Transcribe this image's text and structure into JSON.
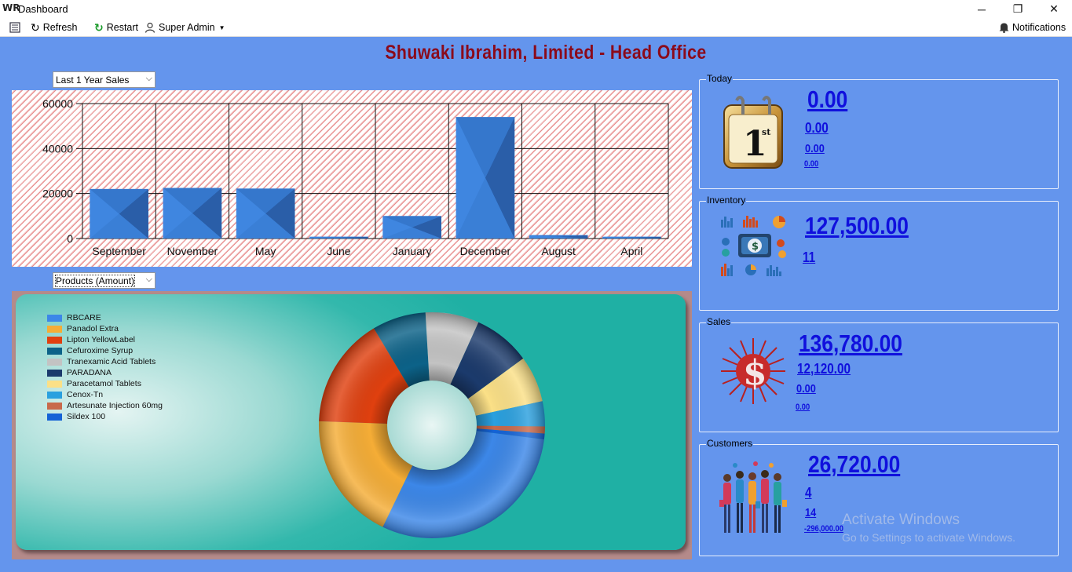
{
  "window": {
    "title": "Dashboard",
    "app_icon_text": "WR",
    "minimize": "─",
    "restore": "❐",
    "close": "✕"
  },
  "toolbar": {
    "refresh_label": "Refresh",
    "restart_label": "Restart",
    "user_label": "Super Admin",
    "notifications_label": "Notifications",
    "icons": [
      "menu-icon",
      "refresh-icon",
      "restart-icon",
      "user-icon",
      "bell-icon"
    ]
  },
  "heading": "Shuwaki Ibrahim, Limited - Head Office",
  "sales_period": {
    "selected": "Last 1 Year Sales"
  },
  "product_mode": {
    "selected": "Products (Amount)"
  },
  "chart_data": [
    {
      "type": "bar",
      "categories": [
        "September",
        "November",
        "May",
        "June",
        "January",
        "December",
        "August",
        "April"
      ],
      "values": [
        22000,
        22500,
        22200,
        800,
        10000,
        54000,
        1500,
        800
      ],
      "ylim": [
        0,
        60000
      ],
      "yticks": [
        "0",
        "20000",
        "40000",
        "60000"
      ],
      "grid": true,
      "colors": {
        "bar_light": "#3f86e0",
        "bar_dark": "#2a5ea8"
      }
    },
    {
      "type": "pie",
      "style": "donut",
      "legend_placement": "top-left",
      "labels": [
        "RBCARE",
        "Panadol Extra",
        "Lipton YellowLabel",
        "Cefuroxime Syrup",
        "Tranexamic Acid Tablets",
        "PARADANA",
        "Paracetamol Tablets",
        "Cenox-Tn",
        "Artesunate Injection 60mg",
        "Sildex 100"
      ],
      "values": [
        29.5,
        18,
        15.5,
        7.5,
        7.5,
        8,
        6.5,
        3.5,
        1,
        0.8
      ],
      "colors": [
        "#3c87e8",
        "#f5ad36",
        "#e0400f",
        "#0c6288",
        "#c3c3c3",
        "#1b3a6c",
        "#fbe087",
        "#2aa0df",
        "#c8694b",
        "#1563d6"
      ]
    }
  ],
  "today": {
    "label": "Today",
    "icon": "calendar-icon",
    "primary": "0.00",
    "second": "0.00",
    "third": "0.00",
    "fourth": "0.00"
  },
  "inventory": {
    "label": "Inventory",
    "icon": "inventory-charts-icon",
    "primary": "127,500.00",
    "second": "11"
  },
  "sales": {
    "label": "Sales",
    "icon": "dollar-burst-icon",
    "primary": "136,780.00",
    "second": "12,120.00",
    "third": "0.00",
    "fourth": "0.00"
  },
  "customers": {
    "label": "Customers",
    "icon": "people-shopping-icon",
    "primary": "26,720.00",
    "second": "4",
    "third": "14",
    "fourth": "-296,000.00"
  },
  "watermark": {
    "line1": "Activate Windows",
    "line2": "Go to Settings to activate Windows."
  }
}
